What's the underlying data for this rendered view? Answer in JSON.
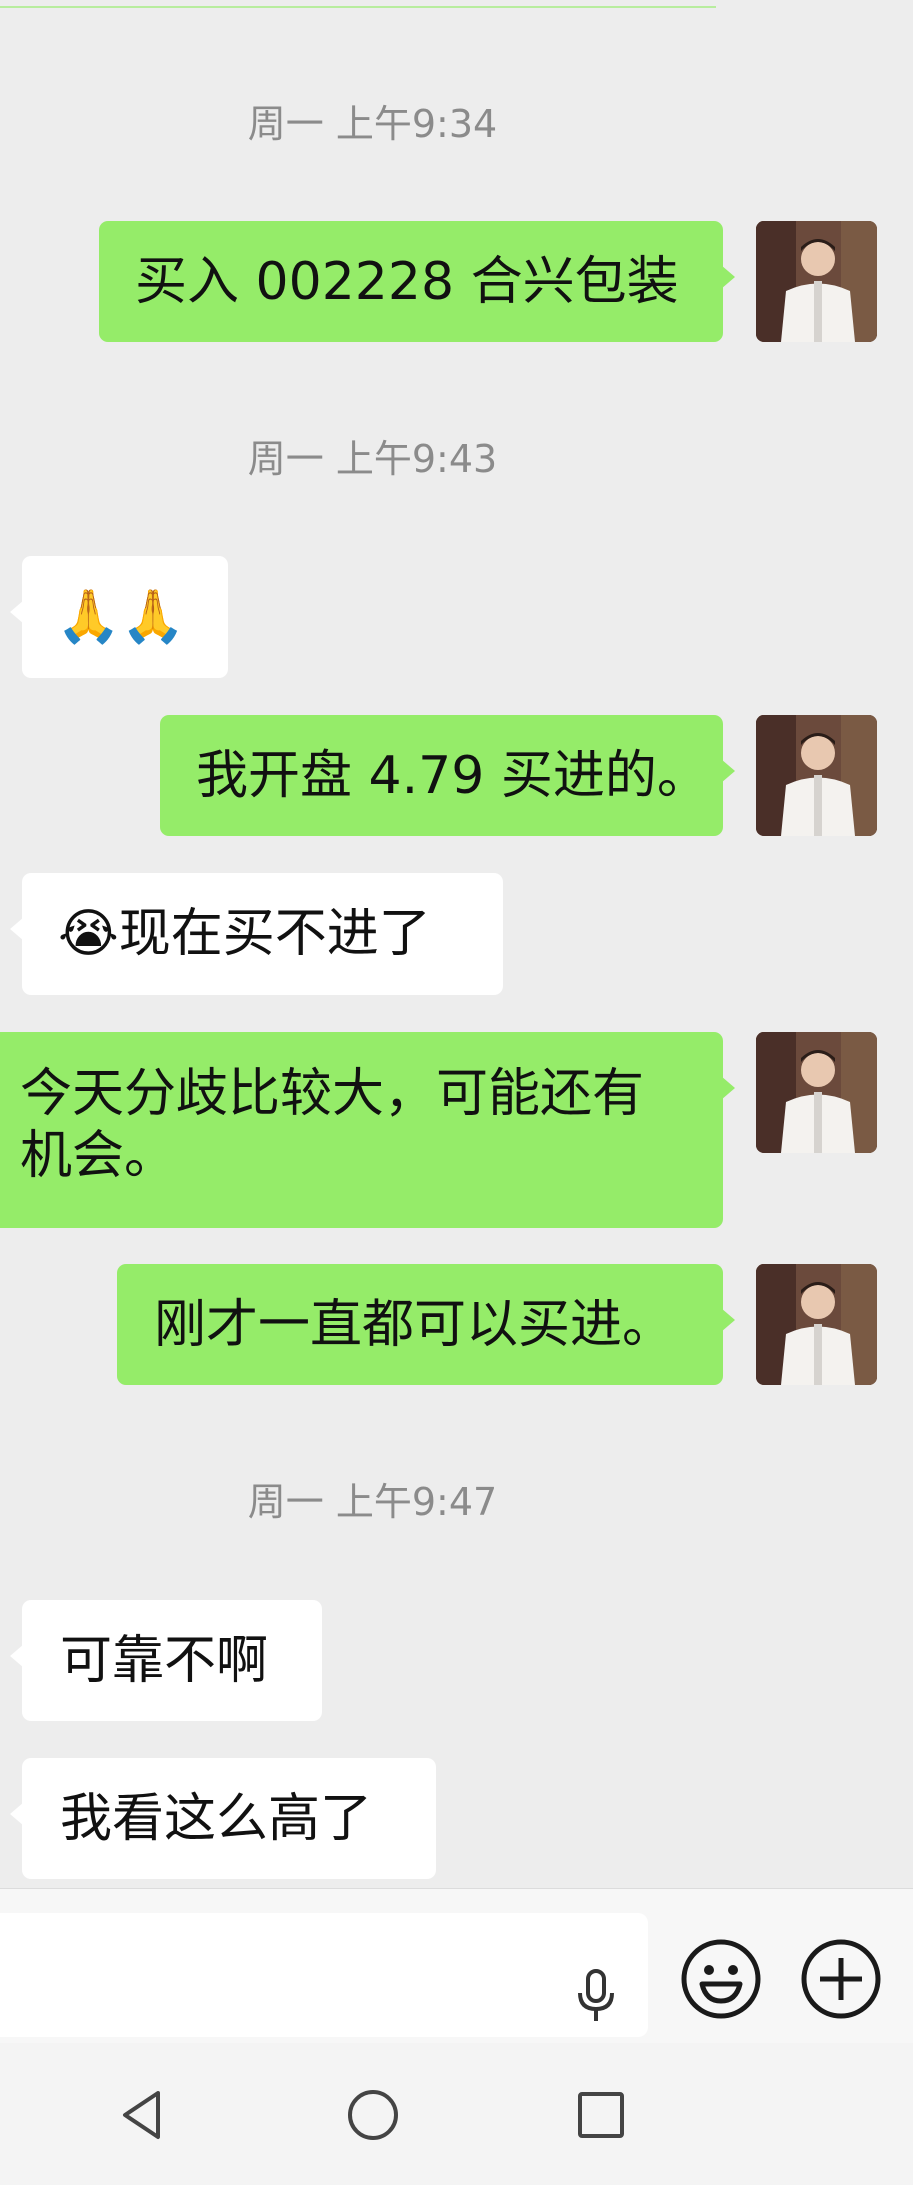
{
  "messages": [
    {
      "kind": "time",
      "text": "周一 上午9:34"
    },
    {
      "kind": "out",
      "text": "买入 002228 合兴包装"
    },
    {
      "kind": "time",
      "text": "周一 上午9:43"
    },
    {
      "kind": "in",
      "text": "🙏🙏"
    },
    {
      "kind": "out",
      "text": "我开盘 4.79 买进的。"
    },
    {
      "kind": "in",
      "text": "😭现在买不进了"
    },
    {
      "kind": "out",
      "line1": "今天分歧比较大，可能还有",
      "line2": "机会。"
    },
    {
      "kind": "out",
      "text": "刚才一直都可以买进。"
    },
    {
      "kind": "time",
      "text": "周一 上午9:47"
    },
    {
      "kind": "in",
      "text": "可靠不啊"
    },
    {
      "kind": "in",
      "text": "我看这么高了"
    }
  ],
  "input_bar": {
    "voice_icon": "microphone-icon",
    "emoji_icon": "smiley-icon",
    "more_icon": "plus-circle-icon",
    "input_value": ""
  },
  "nav_bar": {
    "back_icon": "triangle-back-icon",
    "home_icon": "circle-home-icon",
    "recent_icon": "square-recent-icon"
  },
  "colors": {
    "background": "#ededed",
    "outgoing_bubble": "#95ec69",
    "incoming_bubble": "#ffffff",
    "timestamp": "#8b8b8b"
  }
}
